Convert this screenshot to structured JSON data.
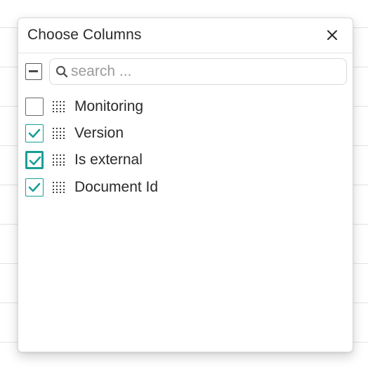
{
  "dialog": {
    "title": "Choose Columns",
    "close_icon": "close-icon"
  },
  "search": {
    "placeholder": "search ...",
    "value": "",
    "icon": "search-icon"
  },
  "select_all": {
    "state": "indeterminate"
  },
  "columns": [
    {
      "label": "Monitoring",
      "checked": false
    },
    {
      "label": "Version",
      "checked": true
    },
    {
      "label": "Is external",
      "checked": true,
      "focused": true
    },
    {
      "label": "Document Id",
      "checked": true
    }
  ],
  "colors": {
    "accent": "#1a9e95",
    "border": "#d9d9d9"
  }
}
